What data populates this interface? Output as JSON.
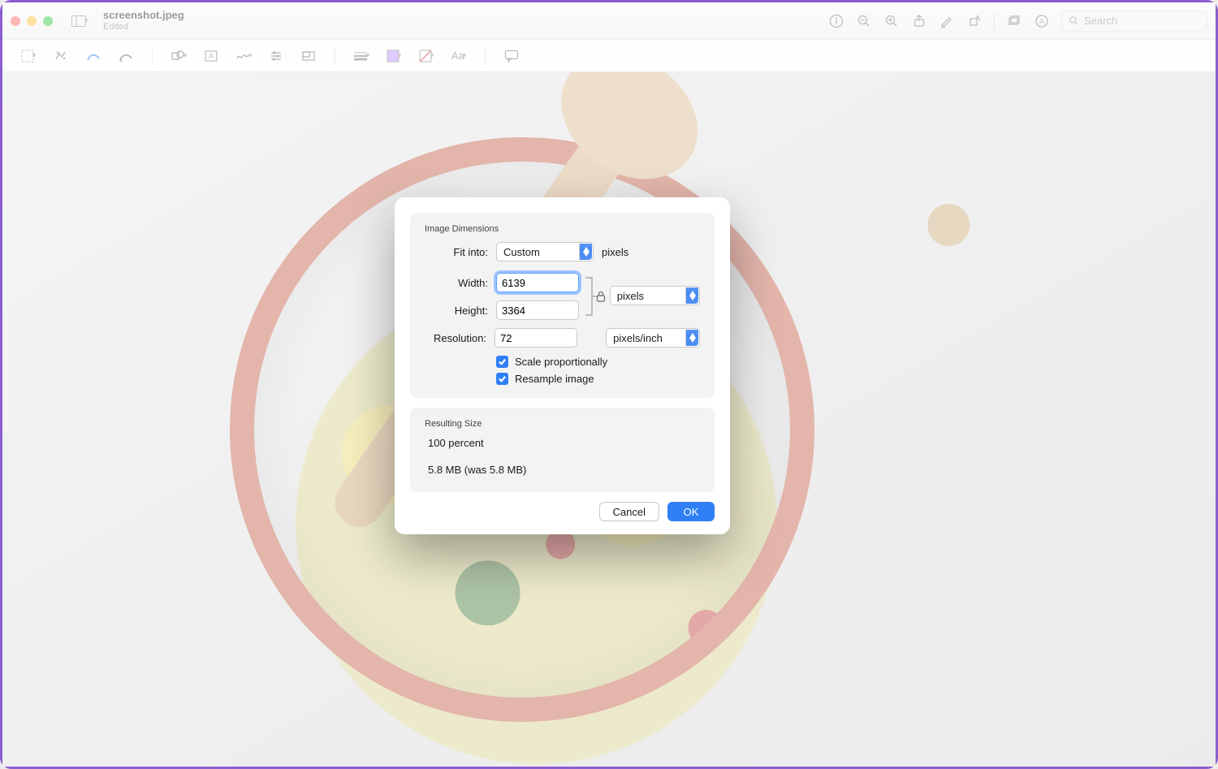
{
  "window": {
    "filename": "screenshot.jpeg",
    "status": "Edited",
    "search_placeholder": "Search"
  },
  "dialog": {
    "section1_title": "Image Dimensions",
    "fit_into_label": "Fit into:",
    "fit_into_value": "Custom",
    "fit_into_unit": "pixels",
    "width_label": "Width:",
    "width_value": "6139",
    "height_label": "Height:",
    "height_value": "3364",
    "wh_unit_value": "pixels",
    "resolution_label": "Resolution:",
    "resolution_value": "72",
    "resolution_unit_value": "pixels/inch",
    "scale_label": "Scale proportionally",
    "resample_label": "Resample image",
    "section2_title": "Resulting Size",
    "percent_line": "100 percent",
    "size_line": "5.8 MB (was 5.8 MB)",
    "cancel": "Cancel",
    "ok": "OK"
  }
}
